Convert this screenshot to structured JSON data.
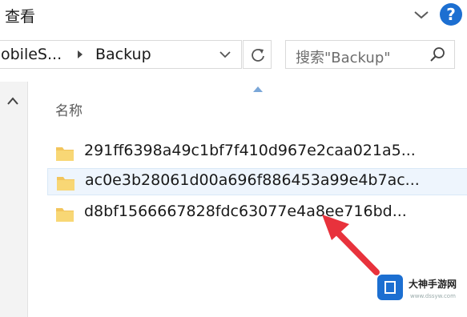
{
  "ribbon": {
    "tab_label": "查看"
  },
  "address": {
    "crumbs": [
      "obileS...",
      "Backup"
    ]
  },
  "search": {
    "placeholder": "搜索\"Backup\""
  },
  "list": {
    "column_name": "名称",
    "items": [
      {
        "name": "291ff6398a49c1bf7f410d967e2caa021a5...",
        "selected": false
      },
      {
        "name": "ac0e3b28061d00a696f886453a99e4b7ac...",
        "selected": true
      },
      {
        "name": "d8bf1566667828fdc63077e4a8ee716bd...",
        "selected": false
      }
    ]
  },
  "annotation": {
    "arrow_color": "#e8323c",
    "target": "d8bf1566667828fdc63077e4a8ee716bd..."
  },
  "watermark": {
    "brand": "大神手游网",
    "url": "www.dssyw.com"
  },
  "colors": {
    "accent": "#1c6fd1",
    "folder": "#f2c55c",
    "selection": "#eef5fd"
  }
}
